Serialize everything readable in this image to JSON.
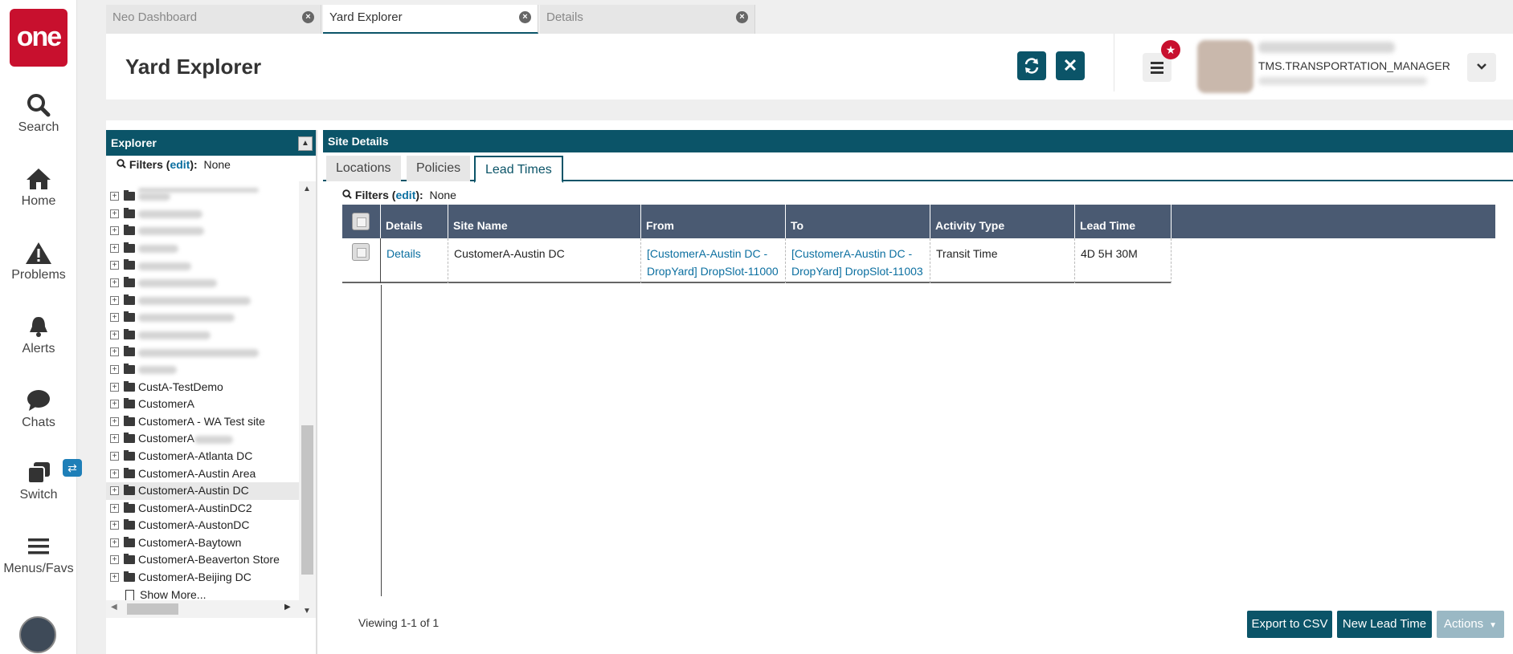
{
  "rail": {
    "logo_text": "one",
    "items": [
      {
        "label": "Search",
        "icon": "search-icon"
      },
      {
        "label": "Home",
        "icon": "home-icon"
      },
      {
        "label": "Problems",
        "icon": "warning-icon"
      },
      {
        "label": "Alerts",
        "icon": "bell-icon"
      },
      {
        "label": "Chats",
        "icon": "chat-icon"
      },
      {
        "label": "Switch",
        "icon": "switch-icon"
      },
      {
        "label": "Menus/Favs",
        "icon": "hamburger-icon"
      }
    ]
  },
  "tabs": [
    {
      "label": "Neo Dashboard",
      "active": false
    },
    {
      "label": "Yard Explorer",
      "active": true
    },
    {
      "label": "Details",
      "active": false
    }
  ],
  "header": {
    "title": "Yard Explorer",
    "user_role": "TMS.TRANSPORTATION_MANAGER"
  },
  "explorer": {
    "title": "Explorer",
    "filters_label": "Filters",
    "filters_edit": "edit",
    "filters_value": "None",
    "items": [
      "CustA-TestDemo",
      "CustomerA",
      "CustomerA - WA Test site",
      "CustomerA",
      "CustomerA-Atlanta DC",
      "CustomerA-Austin Area",
      "CustomerA-Austin DC",
      "CustomerA-AustinDC2",
      "CustomerA-AustonDC",
      "CustomerA-Baytown",
      "CustomerA-Beaverton Store",
      "CustomerA-Beijing DC"
    ],
    "show_more": "Show More..."
  },
  "site_details": {
    "title": "Site Details",
    "tabs": [
      "Locations",
      "Policies",
      "Lead Times"
    ],
    "filters_label": "Filters",
    "filters_edit": "edit",
    "filters_value": "None",
    "columns": [
      "Details",
      "Site Name",
      "From",
      "To",
      "Activity Type",
      "Lead Time"
    ],
    "rows": [
      {
        "details": "Details",
        "site_name": "CustomerA-Austin DC",
        "from_1": "[CustomerA-Austin DC -",
        "from_2": "DropYard] DropSlot-11000",
        "to_1": "[CustomerA-Austin DC -",
        "to_2": "DropYard] DropSlot-11003",
        "activity_type": "Transit Time",
        "lead_time": "4D 5H 30M"
      }
    ],
    "viewing": "Viewing 1-1 of 1",
    "buttons": {
      "export": "Export to CSV",
      "new": "New Lead Time",
      "actions": "Actions"
    }
  }
}
